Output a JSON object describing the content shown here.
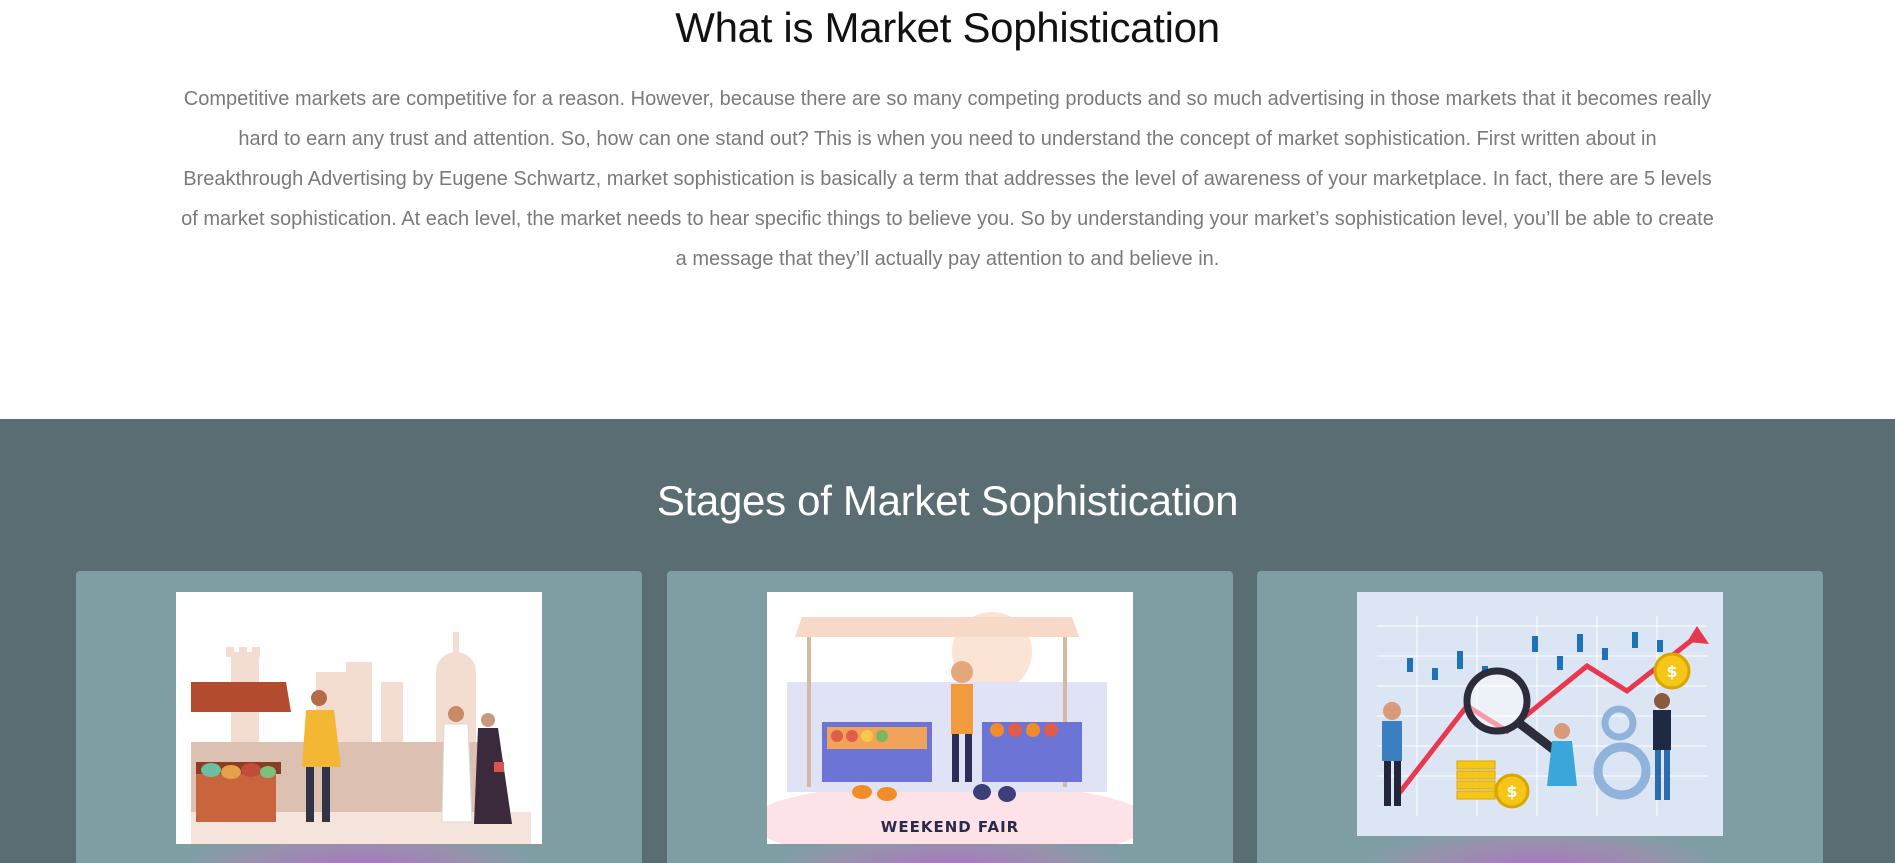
{
  "intro": {
    "title": "What is Market Sophistication",
    "body": "Competitive markets are competitive for a reason. However, because there are so many competing products and so much advertising in those markets that it becomes really hard to earn any trust and attention. So, how can one stand out? This is when you need to understand the concept of market sophistication. First written about in Breakthrough Advertising by Eugene Schwartz, market sophistication is basically a term that addresses the level of awareness of your marketplace. In fact, there are 5 levels of market sophistication. At each level, the market needs to hear specific things to believe you. So by understanding your market’s sophistication level, you’ll be able to create a message that they’ll actually pay attention to and believe in."
  },
  "stages": {
    "title": "Stages of Market Sophistication",
    "cards": [
      {
        "image": "bazaar-market-illustration"
      },
      {
        "image": "weekend-fair-illustration",
        "image_text": "WEEKEND FAIR"
      },
      {
        "image": "market-growth-chart-illustration",
        "coin_symbol": "$"
      }
    ]
  },
  "colors": {
    "section_bg": "#5a6d73",
    "card_bg": "#7f9ea4",
    "heading_dark": "#111111",
    "body_text": "#7a7a7a"
  }
}
